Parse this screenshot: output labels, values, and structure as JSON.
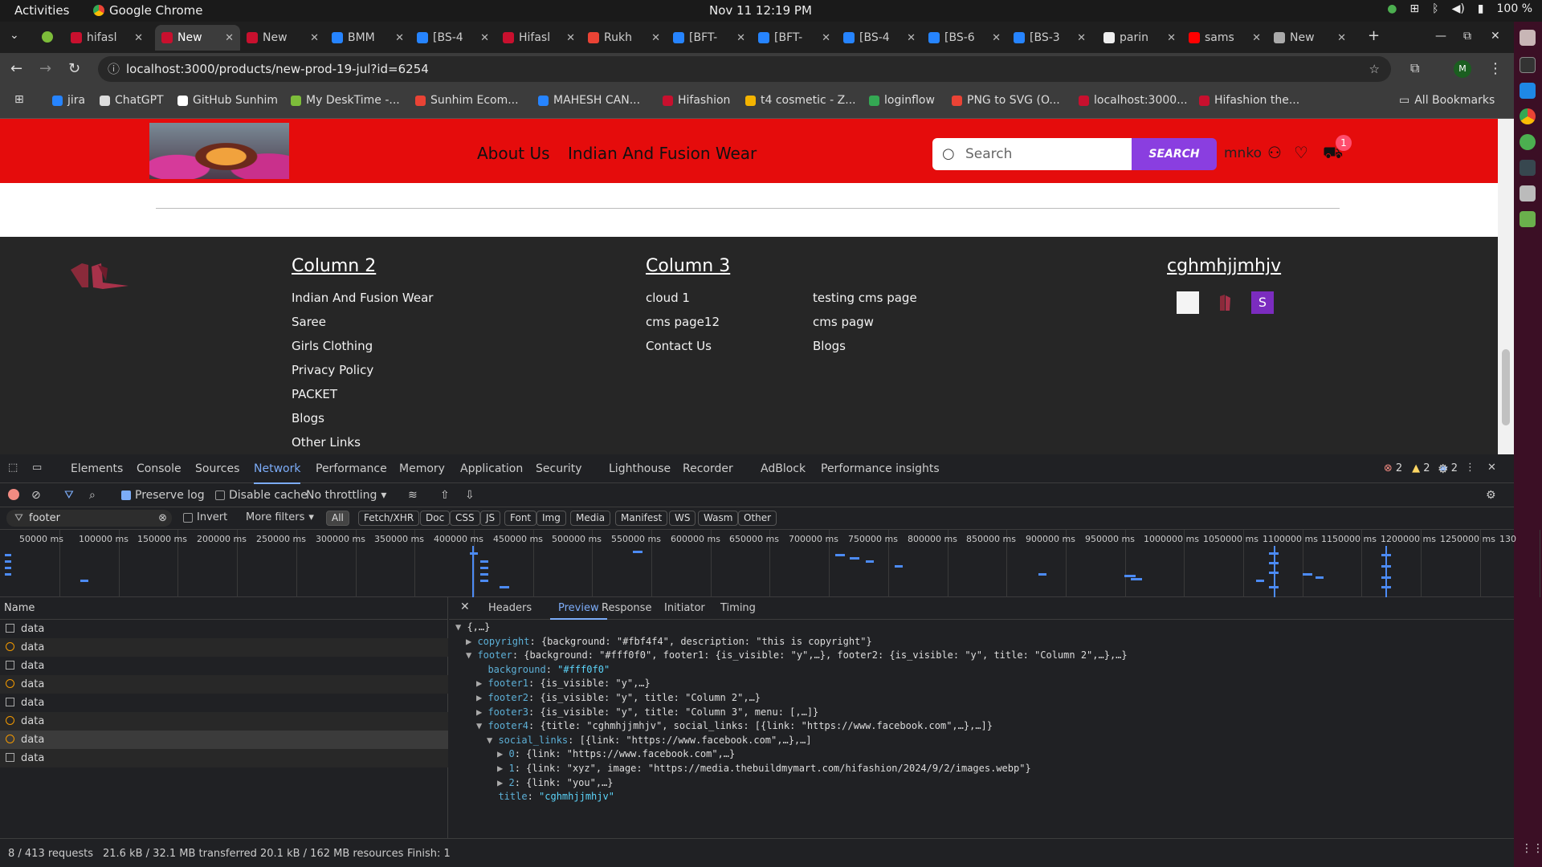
{
  "topbar": {
    "activities": "Activities",
    "app": "Google Chrome",
    "clock": "Nov 11  12:19 PM",
    "battery": "100 %"
  },
  "tabs": [
    {
      "title": "hifasl",
      "color": "#c8102e"
    },
    {
      "title": "New",
      "color": "#c8102e",
      "active": true
    },
    {
      "title": "New",
      "color": "#c8102e"
    },
    {
      "title": "BMM",
      "color": "#2684ff"
    },
    {
      "title": "[BS-4",
      "color": "#2684ff"
    },
    {
      "title": "Hifasl",
      "color": "#c8102e"
    },
    {
      "title": "Rukh",
      "color": "#ea4335"
    },
    {
      "title": "[BFT-",
      "color": "#2684ff"
    },
    {
      "title": "[BFT-",
      "color": "#2684ff"
    },
    {
      "title": "[BS-4",
      "color": "#2684ff"
    },
    {
      "title": "[BS-6",
      "color": "#2684ff"
    },
    {
      "title": "[BS-3",
      "color": "#2684ff"
    },
    {
      "title": "parin",
      "color": "#eeeeee"
    },
    {
      "title": "sams",
      "color": "#ff0000"
    },
    {
      "title": "New",
      "color": "#aaaaaa"
    }
  ],
  "url": "localhost:3000/products/new-prod-19-jul?id=6254",
  "bookmarks": [
    {
      "label": "jira",
      "color": "#2684ff"
    },
    {
      "label": "ChatGPT",
      "color": "#dddddd"
    },
    {
      "label": "GitHub Sunhim",
      "color": "#ffffff"
    },
    {
      "label": "My DeskTime -...",
      "color": "#7dbd3a"
    },
    {
      "label": "Sunhim Ecom...",
      "color": "#ea4335"
    },
    {
      "label": "MAHESH CAN...",
      "color": "#2684ff"
    },
    {
      "label": "Hifashion",
      "color": "#c8102e"
    },
    {
      "label": "t4 cosmetic - Z...",
      "color": "#f4b400"
    },
    {
      "label": "loginflow",
      "color": "#34a853"
    },
    {
      "label": "PNG to SVG (O...",
      "color": "#ea4335"
    },
    {
      "label": "localhost:3000...",
      "color": "#c8102e"
    },
    {
      "label": "Hifashion the...",
      "color": "#c8102e"
    }
  ],
  "all_bookmarks": "All Bookmarks",
  "site": {
    "nav": [
      "About Us",
      "Indian And Fusion Wear"
    ],
    "search_placeholder": "Search",
    "search_button": "SEARCH",
    "user": "mnko",
    "cart_count": "1",
    "colors": {
      "header": "#e50c0c",
      "footer": "#262626",
      "search_btn": "#8a3ee0"
    }
  },
  "footer": {
    "col2": {
      "title": "Column 2",
      "links": [
        "Indian And Fusion Wear",
        "Saree",
        "Girls Clothing",
        "Privacy Policy",
        "PACKET",
        "Blogs",
        "Other Links"
      ]
    },
    "col3": {
      "title": "Column 3",
      "links_a": [
        "cloud 1",
        "cms page12",
        "Contact Us"
      ],
      "links_b": [
        "testing cms page",
        "cms pagw",
        "Blogs"
      ]
    },
    "col4": {
      "title": "cghmhjjmhjv",
      "social_letter": "S"
    }
  },
  "devtools": {
    "tabs": [
      "Elements",
      "Console",
      "Sources",
      "Network",
      "Performance",
      "Memory",
      "Application",
      "Security",
      "Lighthouse",
      "Recorder",
      "AdBlock",
      "Performance insights"
    ],
    "counts": {
      "errors": "2",
      "warnings": "2",
      "messages": "2"
    },
    "preserve_log": "Preserve log",
    "disable_cache": "Disable cache",
    "throttling": "No throttling",
    "filter_value": "footer",
    "invert": "Invert",
    "more_filters": "More filters",
    "type_chips": [
      "All",
      "Fetch/XHR",
      "Doc",
      "CSS",
      "JS",
      "Font",
      "Img",
      "Media",
      "Manifest",
      "WS",
      "Wasm",
      "Other"
    ],
    "timeline_ticks": [
      "50000 ms",
      "100000 ms",
      "150000 ms",
      "200000 ms",
      "250000 ms",
      "300000 ms",
      "350000 ms",
      "400000 ms",
      "450000 ms",
      "500000 ms",
      "550000 ms",
      "600000 ms",
      "650000 ms",
      "700000 ms",
      "750000 ms",
      "800000 ms",
      "850000 ms",
      "900000 ms",
      "950000 ms",
      "1000000 ms",
      "1050000 ms",
      "1100000 ms",
      "1150000 ms",
      "1200000 ms",
      "1250000 ms",
      "130"
    ],
    "name_header": "Name",
    "requests": [
      {
        "name": "data",
        "kind": "doc"
      },
      {
        "name": "data",
        "kind": "js"
      },
      {
        "name": "data",
        "kind": "doc"
      },
      {
        "name": "data",
        "kind": "js"
      },
      {
        "name": "data",
        "kind": "doc"
      },
      {
        "name": "data",
        "kind": "js"
      },
      {
        "name": "data",
        "kind": "js",
        "selected": true
      },
      {
        "name": "data",
        "kind": "doc"
      }
    ],
    "preview_tabs": [
      "Headers",
      "Preview",
      "Response",
      "Initiator",
      "Timing"
    ],
    "preview_lines": [
      {
        "indent": 0,
        "arrow": "▼",
        "key": "",
        "text": "{,…}"
      },
      {
        "indent": 1,
        "arrow": "▶",
        "key": "copyright",
        "text": "{background: \"#fbf4f4\", description: \"this is copyright\"}"
      },
      {
        "indent": 1,
        "arrow": "▼",
        "key": "footer",
        "text": "{background: \"#fff0f0\", footer1: {is_visible: \"y\",…}, footer2: {is_visible: \"y\", title: \"Column 2\",…},…}"
      },
      {
        "indent": 2,
        "arrow": "",
        "key": "background",
        "text": "\"#fff0f0\"",
        "str": true
      },
      {
        "indent": 2,
        "arrow": "▶",
        "key": "footer1",
        "text": "{is_visible: \"y\",…}"
      },
      {
        "indent": 2,
        "arrow": "▶",
        "key": "footer2",
        "text": "{is_visible: \"y\", title: \"Column 2\",…}"
      },
      {
        "indent": 2,
        "arrow": "▶",
        "key": "footer3",
        "text": "{is_visible: \"y\", title: \"Column 3\", menu: [,…]}"
      },
      {
        "indent": 2,
        "arrow": "▼",
        "key": "footer4",
        "text": "{title: \"cghmhjjmhjv\", social_links: [{link: \"https://www.facebook.com\",…},…]}"
      },
      {
        "indent": 3,
        "arrow": "▼",
        "key": "social_links",
        "text": "[{link: \"https://www.facebook.com\",…},…]"
      },
      {
        "indent": 4,
        "arrow": "▶",
        "key": "0",
        "text": "{link: \"https://www.facebook.com\",…}"
      },
      {
        "indent": 4,
        "arrow": "▶",
        "key": "1",
        "text": "{link: \"xyz\", image: \"https://media.thebuildmymart.com/hifashion/2024/9/2/images.webp\"}"
      },
      {
        "indent": 4,
        "arrow": "▶",
        "key": "2",
        "text": "{link: \"you\",…}"
      },
      {
        "indent": 3,
        "arrow": "",
        "key": "title",
        "text": "\"cghmhjjmhjv\"",
        "str": true
      }
    ],
    "status": {
      "requests": "8 / 413 requests",
      "transferred": "21.6 kB / 32.1 MB transferred",
      "resources": "20.1 kB / 162 MB resources",
      "finish": "Finish: 1"
    }
  }
}
